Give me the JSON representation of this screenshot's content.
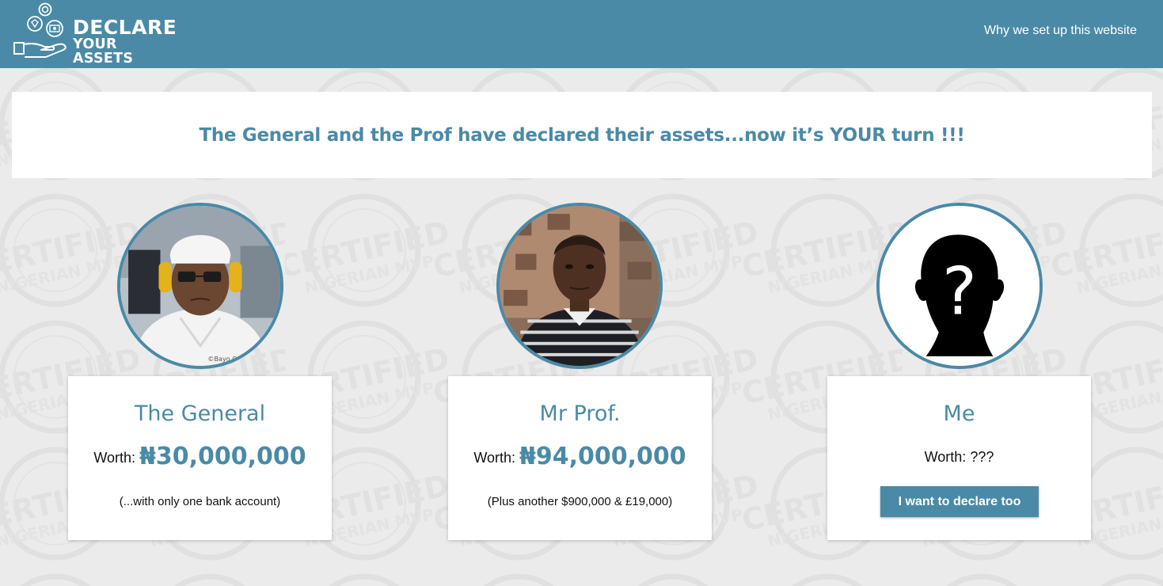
{
  "header": {
    "logo_line1": "DECLARE",
    "logo_line2": "YOUR ASSETS",
    "nav_link": "Why we set up this website"
  },
  "banner": {
    "headline": "The General and the Prof have declared their assets...now it’s YOUR turn !!!"
  },
  "background": {
    "watermark_text_1": "CERTIFIED",
    "watermark_text_2": "NIGERIAN MVP"
  },
  "people": [
    {
      "name": "The General",
      "worth_label": "Worth:",
      "worth_value": "₦30,000,000",
      "note": "(...with only one bank account)",
      "photo_caption": "©Bayo Omoboriowo"
    },
    {
      "name": "Mr Prof.",
      "worth_label": "Worth:",
      "worth_value": "₦94,000,000",
      "note": "(Plus another $900,000 & £19,000)"
    },
    {
      "name": "Me",
      "worth_label": "Worth:",
      "worth_value": "???",
      "button_label": "I want to declare too",
      "avatar_icon": "question-silhouette-icon"
    }
  ],
  "colors": {
    "primary": "#4a8aa6",
    "background": "#ebebeb",
    "card": "#ffffff"
  }
}
